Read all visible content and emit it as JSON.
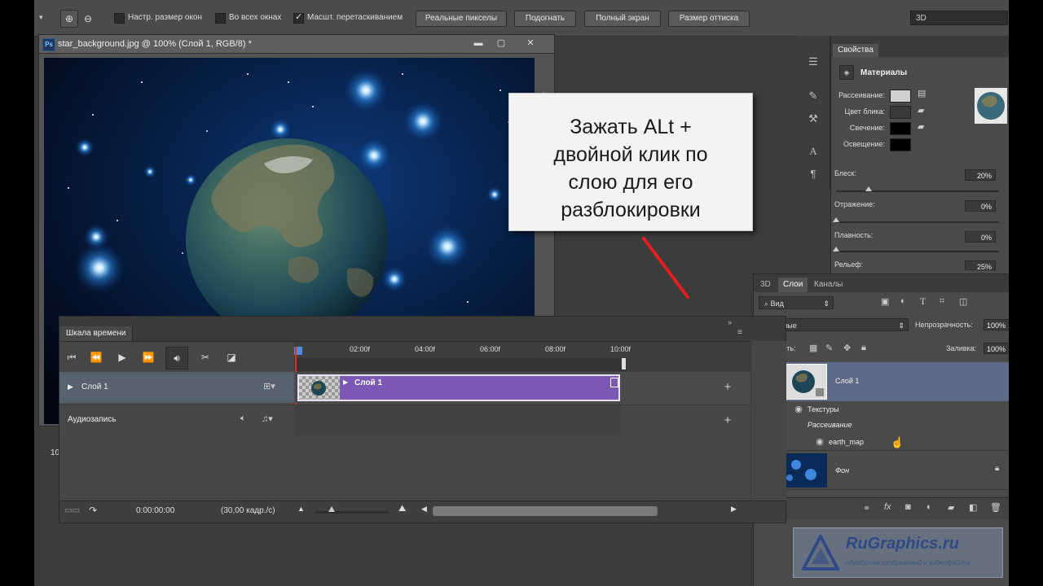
{
  "options_bar": {
    "fit_windows_label": "Настр. размер окон",
    "fit_windows_checked": false,
    "all_windows_label": "Во всех окнах",
    "all_windows_checked": false,
    "scrubby_zoom_label": "Масшт. перетаскиванием",
    "scrubby_zoom_checked": true,
    "actual_pixels": "Реальные пикселы",
    "fit_screen": "Подогнать",
    "fill_screen": "Полный экран",
    "print_size": "Размер оттиска",
    "workspace": "3D"
  },
  "document": {
    "title": "star_background.jpg @ 100% (Слой 1, RGB/8) *",
    "ps_icon": "Ps",
    "zoom_status": "10"
  },
  "callout": {
    "lines": [
      "Зажать ALt +",
      "двойной клик по",
      "слою для его",
      "разблокировки"
    ]
  },
  "timeline": {
    "tab": "Шкала времени",
    "ticks": [
      "02:00f",
      "04:00f",
      "06:00f",
      "08:00f",
      "10:00f"
    ],
    "track1": "Слой 1",
    "clip_label": "Слой 1",
    "audio_track": "Аудиозапись",
    "timecode": "0:00:00:00",
    "fps": "(30,00 кадр./с)"
  },
  "properties": {
    "tab": "Свойства",
    "section": "Материалы",
    "diffuse": "Рассеивание:",
    "specular": "Цвет блика:",
    "illumination": "Свечение:",
    "ambient": "Освещение:",
    "shine_label": "Блеск:",
    "shine_value": "20%",
    "shine_level": 0.2,
    "reflection_label": "Отражение:",
    "reflection_value": "0%",
    "reflection_level": 0.0,
    "roughness_label": "Плавность:",
    "roughness_value": "0%",
    "roughness_level": 0.0,
    "bump_label": "Рельеф:",
    "bump_value": "25%"
  },
  "layers": {
    "tabs": [
      "3D",
      "Слои",
      "Каналы"
    ],
    "active_tab": "Слои",
    "filter_kind": "Вид",
    "blend_mode": "Обычные",
    "opacity_label": "Непрозрачность:",
    "opacity_value": "100%",
    "lock_label": "Закрепить:",
    "fill_label": "Заливка:",
    "fill_value": "100%",
    "layer1": "Слой 1",
    "textures": "Текстуры",
    "diffuse": "Рассеивание",
    "texture_name": "earth_map",
    "background": "Фон"
  },
  "watermark": {
    "title": "RuGraphics.ru",
    "subtitle": "обработка изображений и видеофайлов"
  },
  "icons": [
    "zoom-in-icon",
    "zoom-out-icon",
    "play-icon",
    "scissors-icon",
    "eye-icon",
    "lock-icon",
    "plus-icon"
  ]
}
